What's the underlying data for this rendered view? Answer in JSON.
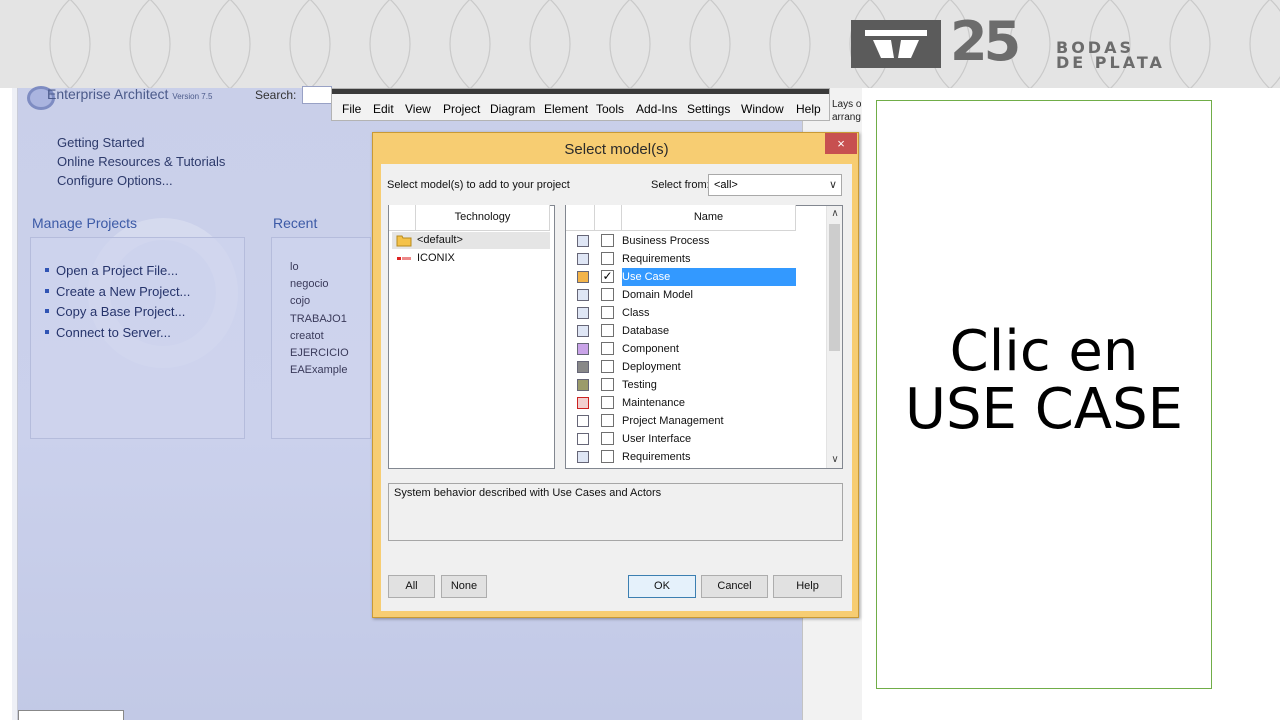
{
  "banner": {
    "logo_number": "25",
    "logo_text_line1": "BODAS",
    "logo_text_line2": "DE PLATA"
  },
  "ea": {
    "title": "Enterprise Architect",
    "version": "Version 7.5",
    "search_label": "Search:",
    "right_text_line1": "Lays o",
    "right_text_line2": "arrang",
    "links": [
      "Getting Started",
      "Online Resources & Tutorials",
      "Configure Options..."
    ],
    "manage_projects_heading": "Manage Projects",
    "recent_heading": "Recent",
    "project_actions": [
      "Open a Project File...",
      "Create a New Project...",
      "Copy a Base Project...",
      "Connect to Server..."
    ],
    "recent_items": [
      "lo",
      "negocio",
      "cojo",
      "TRABAJO1",
      "creatot",
      "EJERCICIO",
      "EAExample"
    ]
  },
  "menubar": {
    "items": [
      "File",
      "Edit",
      "View",
      "Project",
      "Diagram",
      "Element",
      "Tools",
      "Add-Ins",
      "Settings",
      "Window",
      "Help"
    ]
  },
  "dialog": {
    "title": "Select model(s)",
    "close_label": "×",
    "instruction": "Select model(s) to add to your project",
    "select_from_label": "Select from:",
    "select_from_value": "<all>",
    "technology_header": "Technology",
    "name_header": "Name",
    "technologies": [
      {
        "label": "<default>",
        "icon": "folder-icon",
        "selected": true
      },
      {
        "label": "ICONIX",
        "icon": "iconix-icon",
        "selected": false
      }
    ],
    "models": [
      {
        "label": "Business Process",
        "checked": false,
        "selected": false,
        "icon": "business-process-icon"
      },
      {
        "label": "Requirements",
        "checked": false,
        "selected": false,
        "icon": "requirements-icon"
      },
      {
        "label": "Use Case",
        "checked": true,
        "selected": true,
        "icon": "use-case-icon"
      },
      {
        "label": "Domain Model",
        "checked": false,
        "selected": false,
        "icon": "domain-model-icon"
      },
      {
        "label": "Class",
        "checked": false,
        "selected": false,
        "icon": "class-icon"
      },
      {
        "label": "Database",
        "checked": false,
        "selected": false,
        "icon": "database-icon"
      },
      {
        "label": "Component",
        "checked": false,
        "selected": false,
        "icon": "component-icon"
      },
      {
        "label": "Deployment",
        "checked": false,
        "selected": false,
        "icon": "deployment-icon"
      },
      {
        "label": "Testing",
        "checked": false,
        "selected": false,
        "icon": "testing-icon"
      },
      {
        "label": "Maintenance",
        "checked": false,
        "selected": false,
        "icon": "maintenance-icon"
      },
      {
        "label": "Project Management",
        "checked": false,
        "selected": false,
        "icon": "project-management-icon"
      },
      {
        "label": "User Interface",
        "checked": false,
        "selected": false,
        "icon": "user-interface-icon"
      },
      {
        "label": "Requirements",
        "checked": false,
        "selected": false,
        "icon": "requirements-icon"
      }
    ],
    "description": "System behavior described with Use Cases and Actors",
    "buttons": {
      "all": "All",
      "none": "None",
      "ok": "OK",
      "cancel": "Cancel",
      "help": "Help"
    }
  },
  "callout": {
    "line1": "Clic en",
    "line2": "USE CASE"
  },
  "colors": {
    "dialog_frame": "#f7cd72",
    "selection": "#3399ff",
    "callout_border": "#70ad47",
    "close_button": "#c75050"
  }
}
